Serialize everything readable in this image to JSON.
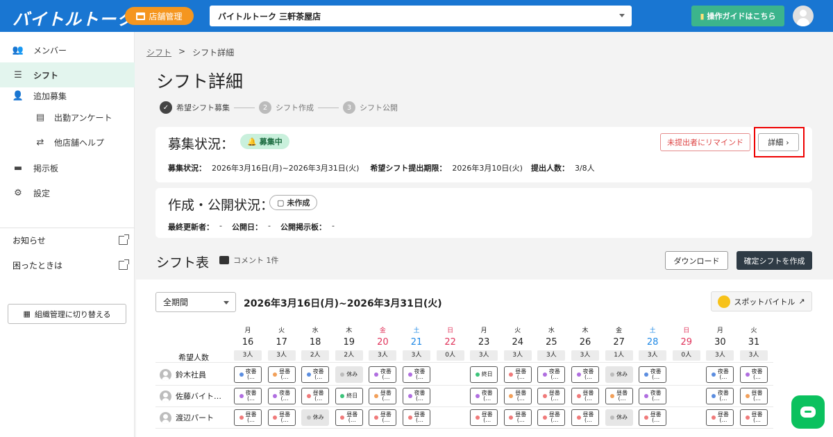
{
  "header": {
    "logo": "バイトルトーク",
    "store_button": "店舗管理",
    "store_select": "バイトルトーク 三軒茶屋店",
    "guide_button": "操作ガイドはこちら"
  },
  "sidebar": {
    "items": [
      {
        "label": "メンバー",
        "icon": "people-icon"
      },
      {
        "label": "シフト",
        "icon": "list-icon"
      },
      {
        "label": "追加募集",
        "icon": "person-add-icon"
      },
      {
        "label": "出勤アンケート",
        "icon": "note-icon"
      },
      {
        "label": "他店舗ヘルプ",
        "icon": "swap-icon"
      },
      {
        "label": "掲示板",
        "icon": "monitor-icon"
      },
      {
        "label": "設定",
        "icon": "gear-icon"
      }
    ],
    "links": [
      {
        "label": "お知らせ"
      },
      {
        "label": "困ったときは"
      }
    ],
    "org_button": "組織管理に切り替える"
  },
  "breadcrumb": {
    "root": "シフト",
    "sep": ">",
    "current": "シフト詳細"
  },
  "page_title": "シフト詳細",
  "steps": [
    {
      "num": "✓",
      "label": "希望シフト募集"
    },
    {
      "num": "2",
      "label": "シフト作成"
    },
    {
      "num": "3",
      "label": "シフト公開"
    }
  ],
  "recruit": {
    "title": "募集状況：",
    "badge": "募集中",
    "period_label": "募集状況：",
    "period_value": "2026年3月16日(月)~2026年3月31日(火)",
    "deadline_label": "希望シフト提出期限：",
    "deadline_value": "2026年3月10日(火)",
    "count_label": "提出人数：",
    "count_value": "3/8人",
    "remind_button": "未提出者にリマインド",
    "detail_button": "詳細"
  },
  "publish": {
    "title": "作成・公開状況：",
    "badge": "未作成",
    "updater_label": "最終更新者：",
    "updater_value": "-",
    "date_label": "公開日：",
    "date_value": "-",
    "board_label": "公開掲示板：",
    "board_value": "-"
  },
  "shift_table": {
    "title": "シフト表",
    "comment": "コメント 1件",
    "download_button": "ダウンロード",
    "confirm_button": "確定シフトを作成",
    "period_select": "全期間",
    "range": "2026年3月16日(月)~2026年3月31日(火)",
    "spot_button": "スポットバイトル",
    "row_head": "希望人数",
    "days": [
      {
        "dow": "月",
        "num": "16",
        "cnt": "3人",
        "color": "#222"
      },
      {
        "dow": "火",
        "num": "17",
        "cnt": "3人",
        "color": "#222"
      },
      {
        "dow": "水",
        "num": "18",
        "cnt": "2人",
        "color": "#222"
      },
      {
        "dow": "木",
        "num": "19",
        "cnt": "2人",
        "color": "#222"
      },
      {
        "dow": "金",
        "num": "20",
        "cnt": "3人",
        "color": "#e0325a"
      },
      {
        "dow": "土",
        "num": "21",
        "cnt": "3人",
        "color": "#1e88e5"
      },
      {
        "dow": "日",
        "num": "22",
        "cnt": "0人",
        "color": "#e0325a"
      },
      {
        "dow": "月",
        "num": "23",
        "cnt": "3人",
        "color": "#222"
      },
      {
        "dow": "火",
        "num": "24",
        "cnt": "3人",
        "color": "#222"
      },
      {
        "dow": "水",
        "num": "25",
        "cnt": "3人",
        "color": "#222"
      },
      {
        "dow": "木",
        "num": "26",
        "cnt": "3人",
        "color": "#222"
      },
      {
        "dow": "金",
        "num": "27",
        "cnt": "1人",
        "color": "#222"
      },
      {
        "dow": "土",
        "num": "28",
        "cnt": "3人",
        "color": "#1e88e5"
      },
      {
        "dow": "日",
        "num": "29",
        "cnt": "0人",
        "color": "#e0325a"
      },
      {
        "dow": "月",
        "num": "30",
        "cnt": "3人",
        "color": "#222"
      },
      {
        "dow": "火",
        "num": "31",
        "cnt": "3人",
        "color": "#222"
      }
    ],
    "employees": [
      {
        "name": "鈴木社員",
        "cells": [
          {
            "t": "s",
            "label": "夜番",
            "sub": "(…",
            "c": "#5b8de0"
          },
          {
            "t": "s",
            "label": "昼番",
            "sub": "(…",
            "c": "#f2a05a"
          },
          {
            "t": "s",
            "label": "夜番",
            "sub": "(…",
            "c": "#5b8de0"
          },
          {
            "t": "o",
            "label": "休み"
          },
          {
            "t": "s",
            "label": "夜番",
            "sub": "(…",
            "c": "#b06ee0"
          },
          {
            "t": "s",
            "label": "夜番",
            "sub": "(…",
            "c": "#b06ee0"
          },
          {
            "t": "n"
          },
          {
            "t": "e",
            "label": "終日",
            "c": "#3cc47a"
          },
          {
            "t": "s",
            "label": "昼番",
            "sub": "(…",
            "c": "#f07a7a"
          },
          {
            "t": "s",
            "label": "夜番",
            "sub": "(…",
            "c": "#b06ee0"
          },
          {
            "t": "s",
            "label": "夜番",
            "sub": "(…",
            "c": "#b06ee0"
          },
          {
            "t": "o",
            "label": "休み"
          },
          {
            "t": "s",
            "label": "夜番",
            "sub": "(…",
            "c": "#5b8de0"
          },
          {
            "t": "n"
          },
          {
            "t": "s",
            "label": "夜番",
            "sub": "(…",
            "c": "#5b8de0"
          },
          {
            "t": "s",
            "label": "夜番",
            "sub": "(…",
            "c": "#b06ee0"
          }
        ]
      },
      {
        "name": "佐藤バイト…",
        "cells": [
          {
            "t": "s",
            "label": "夜番",
            "sub": "(…",
            "c": "#b06ee0"
          },
          {
            "t": "s",
            "label": "夜番",
            "sub": "(…",
            "c": "#b06ee0"
          },
          {
            "t": "s",
            "label": "昼番",
            "sub": "(…",
            "c": "#f07a7a"
          },
          {
            "t": "e",
            "label": "終日",
            "c": "#3cc47a"
          },
          {
            "t": "s",
            "label": "昼番",
            "sub": "(…",
            "c": "#f2a05a"
          },
          {
            "t": "s",
            "label": "夜番",
            "sub": "(…",
            "c": "#b06ee0"
          },
          {
            "t": "n"
          },
          {
            "t": "s",
            "label": "夜番",
            "sub": "(…",
            "c": "#b06ee0"
          },
          {
            "t": "s",
            "label": "昼番",
            "sub": "(…",
            "c": "#f2a05a"
          },
          {
            "t": "s",
            "label": "昼番",
            "sub": "(…",
            "c": "#f07a7a"
          },
          {
            "t": "s",
            "label": "昼番",
            "sub": "(…",
            "c": "#f07a7a"
          },
          {
            "t": "s",
            "label": "昼番",
            "sub": "(…",
            "c": "#f2a05a"
          },
          {
            "t": "s",
            "label": "夜番",
            "sub": "(…",
            "c": "#b06ee0"
          },
          {
            "t": "n"
          },
          {
            "t": "s",
            "label": "夜番",
            "sub": "(…",
            "c": "#5b8de0"
          },
          {
            "t": "s",
            "label": "昼番",
            "sub": "(…",
            "c": "#f2a05a"
          }
        ]
      },
      {
        "name": "渡辺パート",
        "cells": [
          {
            "t": "s",
            "label": "昼番",
            "sub": "(…",
            "c": "#f07a7a"
          },
          {
            "t": "s",
            "label": "昼番",
            "sub": "(…",
            "c": "#f07a7a"
          },
          {
            "t": "o",
            "label": "休み"
          },
          {
            "t": "s",
            "label": "昼番",
            "sub": "(…",
            "c": "#f07a7a"
          },
          {
            "t": "s",
            "label": "昼番",
            "sub": "(…",
            "c": "#f07a7a"
          },
          {
            "t": "s",
            "label": "昼番",
            "sub": "(…",
            "c": "#f07a7a"
          },
          {
            "t": "n"
          },
          {
            "t": "s",
            "label": "昼番",
            "sub": "(…",
            "c": "#f07a7a"
          },
          {
            "t": "s",
            "label": "昼番",
            "sub": "(…",
            "c": "#f07a7a"
          },
          {
            "t": "s",
            "label": "昼番",
            "sub": "(…",
            "c": "#f07a7a"
          },
          {
            "t": "s",
            "label": "昼番",
            "sub": "(…",
            "c": "#f07a7a"
          },
          {
            "t": "o",
            "label": "休み"
          },
          {
            "t": "s",
            "label": "昼番",
            "sub": "(…",
            "c": "#f07a7a"
          },
          {
            "t": "n"
          },
          {
            "t": "s",
            "label": "昼番",
            "sub": "(…",
            "c": "#f07a7a"
          },
          {
            "t": "s",
            "label": "昼番",
            "sub": "(…",
            "c": "#f07a7a"
          }
        ]
      }
    ]
  }
}
